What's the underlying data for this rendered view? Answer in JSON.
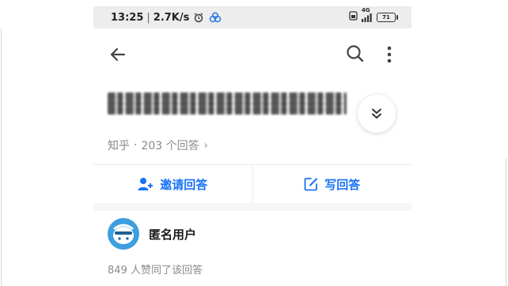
{
  "status_bar": {
    "time": "13:25",
    "separator": "|",
    "speed": "2.7K/s",
    "network": "4G",
    "battery": "71"
  },
  "toolbar": {
    "back_icon": "arrow-left-icon",
    "search_icon": "search-icon",
    "more_icon": "more-vertical-icon"
  },
  "question": {
    "title": "",
    "expand_icon": "chevron-double-down-icon"
  },
  "meta": {
    "source": "知乎",
    "separator": "·",
    "answer_count": "203 个回答",
    "arrow": "›"
  },
  "actions": {
    "invite_label": "邀请回答",
    "invite_icon": "add-user-icon",
    "write_label": "写回答",
    "write_icon": "edit-icon"
  },
  "answer": {
    "author_name": "匿名用户",
    "likes_text": "849 人赞同了该回答"
  },
  "colors": {
    "accent": "#1772f6",
    "muted": "#8a8a8a",
    "status_bg": "#ededed",
    "avatar": "#3d9ee0"
  }
}
